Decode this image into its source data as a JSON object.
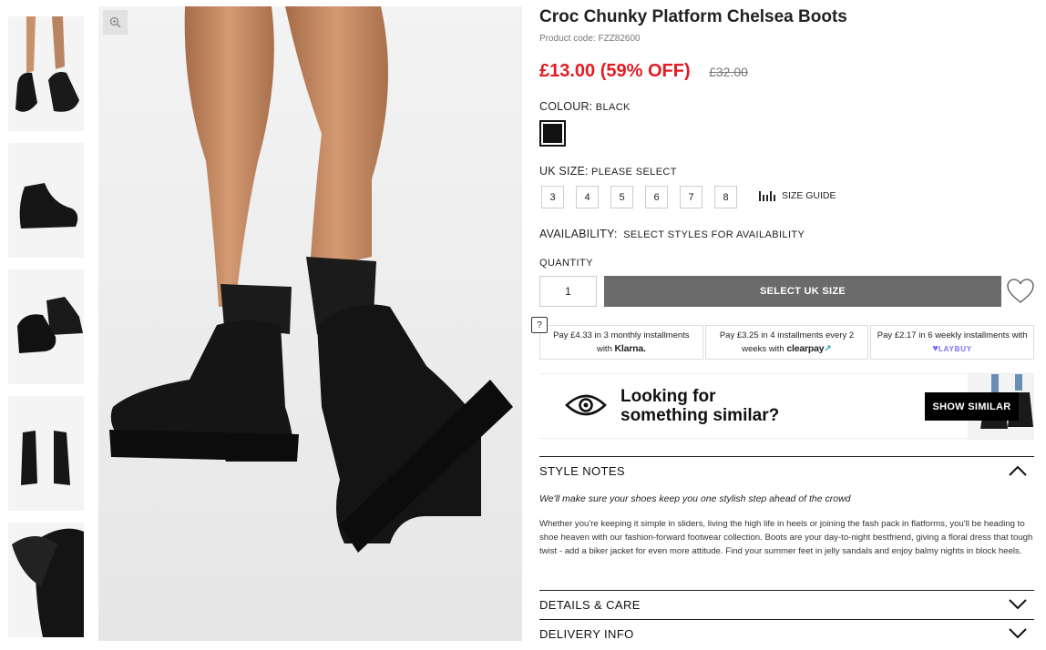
{
  "product": {
    "title": "Croc Chunky Platform Chelsea Boots",
    "code": "Product code: FZZ82600",
    "price": "£13.00 (59% OFF)",
    "old_price": "£32.00"
  },
  "colour": {
    "label": "COLOUR:",
    "value": "BLACK",
    "swatch_color": "#111111"
  },
  "size": {
    "label": "UK SIZE:",
    "value": "PLEASE SELECT",
    "options": [
      "3",
      "4",
      "5",
      "6",
      "7",
      "8"
    ],
    "guide_label": "SIZE GUIDE"
  },
  "availability": {
    "label": "AVAILABILITY:",
    "value": "SELECT STYLES FOR AVAILABILITY"
  },
  "quantity": {
    "label": "QUANTITY",
    "value": "1"
  },
  "add_button": "SELECT UK SIZE",
  "help_icon": "?",
  "payments": {
    "klarna": {
      "prefix": "Pay ",
      "amount": "£4.33",
      "middle": " in 3 monthly installments with ",
      "brand": "Klarna."
    },
    "clearpay": {
      "prefix": "Pay ",
      "amount": "£3.25",
      "middle": " in 4 installments every 2 weeks with ",
      "brand": "clearpay"
    },
    "laybuy": {
      "prefix": "Pay ",
      "amount": "£2.17",
      "middle": " in 6 weekly installments with ",
      "brand": "LAYBUY"
    }
  },
  "similar": {
    "line1": "Looking for",
    "line2": "something similar?",
    "button": "SHOW SIMILAR"
  },
  "accordions": {
    "style_notes": "STYLE NOTES",
    "details": "DETAILS & CARE",
    "delivery": "DELIVERY INFO"
  },
  "style_notes": {
    "tagline": "We'll make sure your shoes keep you one stylish step ahead of the crowd",
    "body": "Whether you're keeping it simple in sliders, living the high life in heels or joining the fash pack in flatforms, you'll be heading to shoe heaven with our fashion-forward footwear collection. Boots are your day-to-night bestfriend, giving a floral dress that tough twist - add a biker jacket for even more attitude. Find your summer feet in jelly sandals and enjoy balmy nights in block heels."
  },
  "colors": {
    "price_red": "#e31b23",
    "button_grey": "#6b6b6b",
    "laybuy_purple": "#786dff"
  }
}
